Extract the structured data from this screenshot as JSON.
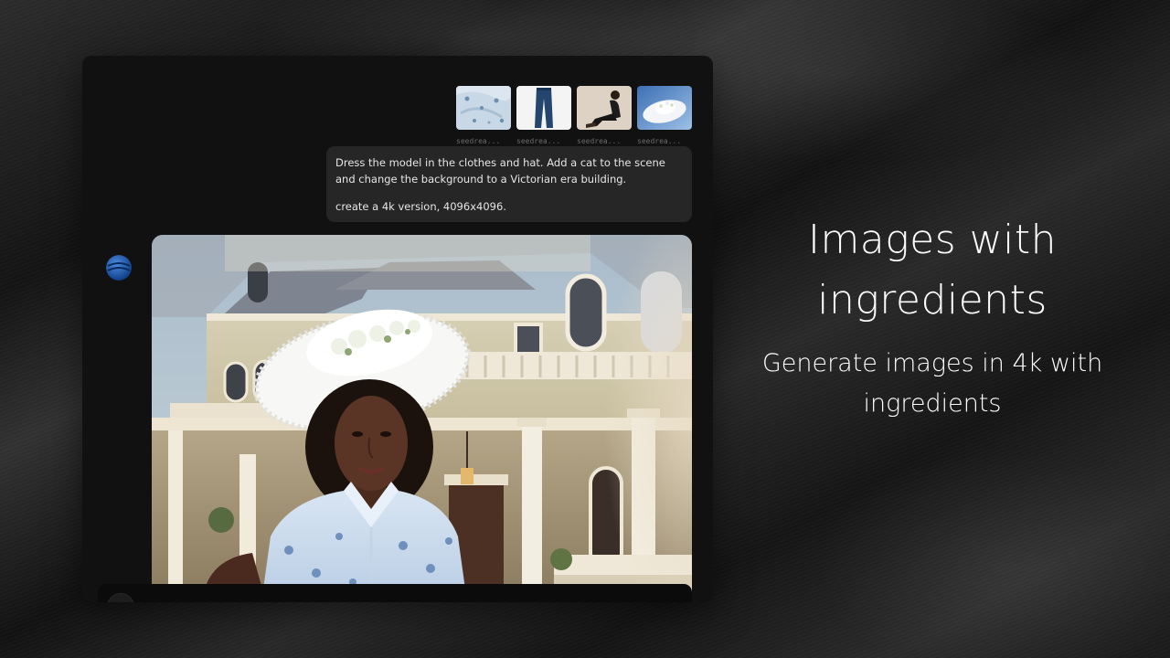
{
  "attachments": [
    {
      "label": "seedrea...",
      "icon": "floral-fabric-thumbnail"
    },
    {
      "label": "seedrea...",
      "icon": "blue-trousers-thumbnail"
    },
    {
      "label": "seedrea...",
      "icon": "model-photo-thumbnail"
    },
    {
      "label": "seedrea...",
      "icon": "white-hat-thumbnail"
    }
  ],
  "prompt": {
    "line1": "Dress the model in the clothes and hat. Add a cat to the scene and change the background to a Victorian era building.",
    "line2": "create a 4k version, 4096x4096."
  },
  "assistant": {
    "avatar_icon": "blue-sphere-logo-icon"
  },
  "result": {
    "description_icon": "generated-image-woman-victorian-house"
  },
  "input_bar": {
    "placeholder": ""
  },
  "headline": {
    "title": "Images with ingredients",
    "subtitle": "Generate images in 4k with ingredients"
  },
  "colors": {
    "panel_bg": "#111111",
    "bubble_bg": "#262626",
    "accent_blue": "#1e5fb8",
    "text_primary": "#ffffff"
  }
}
